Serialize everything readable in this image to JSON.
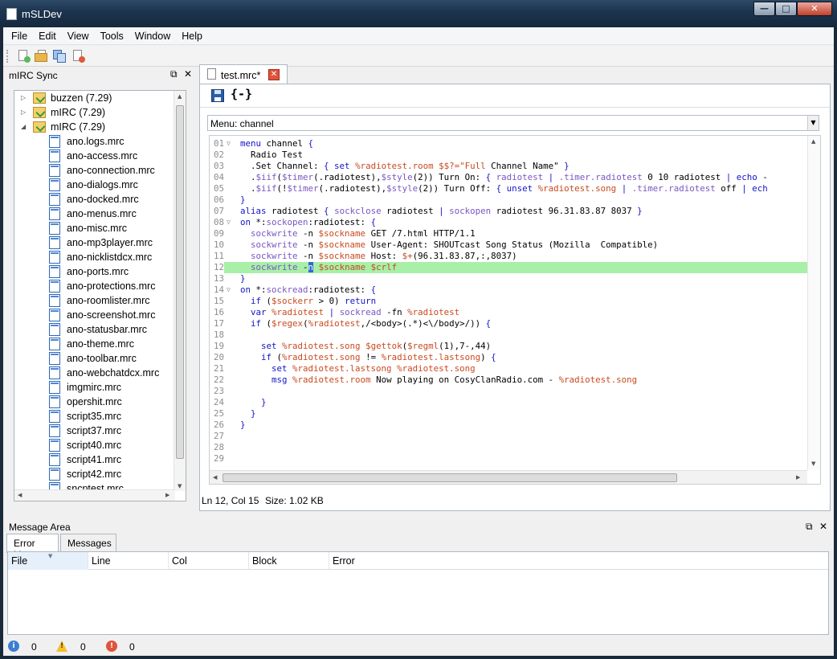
{
  "window": {
    "title": "mSLDev",
    "buttons": {
      "minimize": "—",
      "maximize": "□",
      "close": "✕"
    }
  },
  "menu": [
    "File",
    "Edit",
    "View",
    "Tools",
    "Window",
    "Help"
  ],
  "toolbar": {
    "icons": [
      "new-file-icon",
      "open-folder-icon",
      "copy-icon",
      "delete-file-icon"
    ]
  },
  "left_pane": {
    "title": "mIRC Sync",
    "controls": {
      "float": "⧉",
      "close": "✕"
    },
    "tree": [
      {
        "label": "buzzen (7.29)",
        "expanded": false
      },
      {
        "label": "mIRC (7.29)",
        "expanded": false
      },
      {
        "label": "mIRC (7.29)",
        "expanded": true
      }
    ],
    "files": [
      "ano.logs.mrc",
      "ano-access.mrc",
      "ano-connection.mrc",
      "ano-dialogs.mrc",
      "ano-docked.mrc",
      "ano-menus.mrc",
      "ano-misc.mrc",
      "ano-mp3player.mrc",
      "ano-nicklistdcx.mrc",
      "ano-ports.mrc",
      "ano-protections.mrc",
      "ano-roomlister.mrc",
      "ano-screenshot.mrc",
      "ano-statusbar.mrc",
      "ano-theme.mrc",
      "ano-toolbar.mrc",
      "ano-webchatdcx.mrc",
      "imgmirc.mrc",
      "opershit.mrc",
      "script35.mrc",
      "script37.mrc",
      "script40.mrc",
      "script41.mrc",
      "script42.mrc",
      "sncptest.mrc"
    ]
  },
  "editor": {
    "tab_label": "test.mrc*",
    "tab_close": "✕",
    "braces_icon": "{-}",
    "menu_select": {
      "value": "Menu: channel"
    },
    "highlighted_line": 12,
    "lines": [
      {
        "n": "01",
        "fold": "▽",
        "html": "<span class=\"k\">menu</span> channel <span class=\"k\">{</span>"
      },
      {
        "n": "02",
        "fold": "",
        "html": "  Radio Test"
      },
      {
        "n": "03",
        "fold": "",
        "html": "  .Set Channel: <span class=\"k\">{</span> <span class=\"k\">set</span> <span class=\"v\">%radiotest.room</span> <span class=\"v\">$$?=\"Full</span> Channel Name\" <span class=\"k\">}</span>"
      },
      {
        "n": "04",
        "fold": "",
        "html": "  .<span class=\"f\">$iif</span>(<span class=\"f\">$timer</span>(.radiotest),<span class=\"f\">$style</span>(2)) Turn On: <span class=\"k\">{</span> <span class=\"f\">radiotest</span> <span class=\"k\">|</span> <span class=\"f\">.timer.radiotest</span> 0 10 radiotest <span class=\"k\">|</span> <span class=\"k\">echo</span> -"
      },
      {
        "n": "05",
        "fold": "",
        "html": "  .<span class=\"f\">$iif</span>(!<span class=\"f\">$timer</span>(.radiotest),<span class=\"f\">$style</span>(2)) Turn Off: <span class=\"k\">{</span> <span class=\"k\">unset</span> <span class=\"v\">%radiotest.song</span> <span class=\"k\">|</span> <span class=\"f\">.timer.radiotest</span> off <span class=\"k\">|</span> <span class=\"k\">ech</span>"
      },
      {
        "n": "06",
        "fold": "",
        "html": "<span class=\"k\">}</span>"
      },
      {
        "n": "07",
        "fold": "",
        "html": "<span class=\"k\">alias</span> radiotest <span class=\"k\">{</span> <span class=\"f\">sockclose</span> radiotest <span class=\"k\">|</span> <span class=\"f\">sockopen</span> radiotest 96.31.83.87 8037 <span class=\"k\">}</span>"
      },
      {
        "n": "08",
        "fold": "▽",
        "html": "<span class=\"k\">on</span> *:<span class=\"f\">sockopen</span>:radiotest: <span class=\"k\">{</span>"
      },
      {
        "n": "09",
        "fold": "",
        "html": "  <span class=\"f\">sockwrite</span> -n <span class=\"v\">$sockname</span> GET /7.html HTTP/1.1"
      },
      {
        "n": "10",
        "fold": "",
        "html": "  <span class=\"f\">sockwrite</span> -n <span class=\"v\">$sockname</span> User-Agent: SHOUTcast Song Status (Mozilla  Compatible)"
      },
      {
        "n": "11",
        "fold": "",
        "html": "  <span class=\"f\">sockwrite</span> -n <span class=\"v\">$sockname</span> Host: <span class=\"v\">$+</span>(96.31.83.87,:,8037)"
      },
      {
        "n": "12",
        "fold": "",
        "html": "  <span class=\"f\">sockwrite</span> -<span class=\"cur\">n</span> <span class=\"v\">$sockname</span> <span class=\"v\">$crlf</span>"
      },
      {
        "n": "13",
        "fold": "",
        "html": "<span class=\"k\">}</span>"
      },
      {
        "n": "14",
        "fold": "▽",
        "html": "<span class=\"k\">on</span> *:<span class=\"f\">sockread</span>:radiotest: <span class=\"k\">{</span>"
      },
      {
        "n": "15",
        "fold": "",
        "html": "  <span class=\"k\">if</span> (<span class=\"v\">$sockerr</span> &gt; 0) <span class=\"k\">return</span>"
      },
      {
        "n": "16",
        "fold": "",
        "html": "  <span class=\"k\">var</span> <span class=\"v\">%radiotest</span> <span class=\"k\">|</span> <span class=\"f\">sockread</span> -fn <span class=\"v\">%radiotest</span>"
      },
      {
        "n": "17",
        "fold": "",
        "html": "  <span class=\"k\">if</span> (<span class=\"v\">$regex</span>(<span class=\"v\">%radiotest</span>,/&lt;body&gt;(.*)&lt;\\/body&gt;/)) <span class=\"k\">{</span>"
      },
      {
        "n": "18",
        "fold": "",
        "html": ""
      },
      {
        "n": "19",
        "fold": "",
        "html": "    <span class=\"k\">set</span> <span class=\"v\">%radiotest.song</span> <span class=\"v\">$gettok</span>(<span class=\"v\">$regml</span>(1),7-,44)"
      },
      {
        "n": "20",
        "fold": "",
        "html": "    <span class=\"k\">if</span> (<span class=\"v\">%radiotest.song</span> != <span class=\"v\">%radiotest.lastsong</span>) <span class=\"k\">{</span>"
      },
      {
        "n": "21",
        "fold": "",
        "html": "      <span class=\"k\">set</span> <span class=\"v\">%radiotest.lastsong</span> <span class=\"v\">%radiotest.song</span>"
      },
      {
        "n": "22",
        "fold": "",
        "html": "      <span class=\"k\">msg</span> <span class=\"v\">%radiotest.room</span> Now playing on CosyClanRadio.com - <span class=\"v\">%radiotest.song</span>"
      },
      {
        "n": "23",
        "fold": "",
        "html": ""
      },
      {
        "n": "24",
        "fold": "",
        "html": "    <span class=\"k\">}</span>"
      },
      {
        "n": "25",
        "fold": "",
        "html": "  <span class=\"k\">}</span>"
      },
      {
        "n": "26",
        "fold": "",
        "html": "<span class=\"k\">}</span>"
      },
      {
        "n": "27",
        "fold": "",
        "html": ""
      },
      {
        "n": "28",
        "fold": "",
        "html": ""
      },
      {
        "n": "29",
        "fold": "",
        "html": ""
      }
    ]
  },
  "status": {
    "position": "Ln 12, Col 15",
    "size": "Size: 1.02 KB"
  },
  "message_area": {
    "title": "Message Area",
    "controls": {
      "float": "⧉",
      "close": "✕"
    },
    "tabs": [
      "Error List",
      "Messages"
    ],
    "columns": [
      "File",
      "Line",
      "Col",
      "Block",
      "Error"
    ],
    "counts": {
      "info": "0",
      "warnings": "0",
      "errors": "0"
    },
    "count_icons": {
      "info": "i",
      "warnings": "!",
      "errors": "!"
    }
  }
}
